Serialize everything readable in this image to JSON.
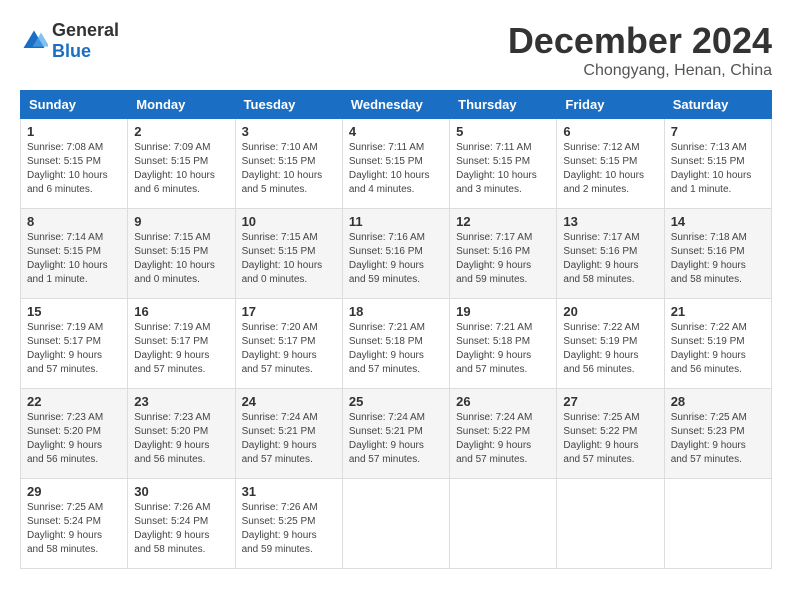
{
  "logo": {
    "text_general": "General",
    "text_blue": "Blue"
  },
  "header": {
    "month": "December 2024",
    "location": "Chongyang, Henan, China"
  },
  "weekdays": [
    "Sunday",
    "Monday",
    "Tuesday",
    "Wednesday",
    "Thursday",
    "Friday",
    "Saturday"
  ],
  "weeks": [
    [
      {
        "day": "1",
        "sunrise": "7:08 AM",
        "sunset": "5:15 PM",
        "daylight": "10 hours and 6 minutes."
      },
      {
        "day": "2",
        "sunrise": "7:09 AM",
        "sunset": "5:15 PM",
        "daylight": "10 hours and 6 minutes."
      },
      {
        "day": "3",
        "sunrise": "7:10 AM",
        "sunset": "5:15 PM",
        "daylight": "10 hours and 5 minutes."
      },
      {
        "day": "4",
        "sunrise": "7:11 AM",
        "sunset": "5:15 PM",
        "daylight": "10 hours and 4 minutes."
      },
      {
        "day": "5",
        "sunrise": "7:11 AM",
        "sunset": "5:15 PM",
        "daylight": "10 hours and 3 minutes."
      },
      {
        "day": "6",
        "sunrise": "7:12 AM",
        "sunset": "5:15 PM",
        "daylight": "10 hours and 2 minutes."
      },
      {
        "day": "7",
        "sunrise": "7:13 AM",
        "sunset": "5:15 PM",
        "daylight": "10 hours and 1 minute."
      }
    ],
    [
      {
        "day": "8",
        "sunrise": "7:14 AM",
        "sunset": "5:15 PM",
        "daylight": "10 hours and 1 minute."
      },
      {
        "day": "9",
        "sunrise": "7:15 AM",
        "sunset": "5:15 PM",
        "daylight": "10 hours and 0 minutes."
      },
      {
        "day": "10",
        "sunrise": "7:15 AM",
        "sunset": "5:15 PM",
        "daylight": "10 hours and 0 minutes."
      },
      {
        "day": "11",
        "sunrise": "7:16 AM",
        "sunset": "5:16 PM",
        "daylight": "9 hours and 59 minutes."
      },
      {
        "day": "12",
        "sunrise": "7:17 AM",
        "sunset": "5:16 PM",
        "daylight": "9 hours and 59 minutes."
      },
      {
        "day": "13",
        "sunrise": "7:17 AM",
        "sunset": "5:16 PM",
        "daylight": "9 hours and 58 minutes."
      },
      {
        "day": "14",
        "sunrise": "7:18 AM",
        "sunset": "5:16 PM",
        "daylight": "9 hours and 58 minutes."
      }
    ],
    [
      {
        "day": "15",
        "sunrise": "7:19 AM",
        "sunset": "5:17 PM",
        "daylight": "9 hours and 57 minutes."
      },
      {
        "day": "16",
        "sunrise": "7:19 AM",
        "sunset": "5:17 PM",
        "daylight": "9 hours and 57 minutes."
      },
      {
        "day": "17",
        "sunrise": "7:20 AM",
        "sunset": "5:17 PM",
        "daylight": "9 hours and 57 minutes."
      },
      {
        "day": "18",
        "sunrise": "7:21 AM",
        "sunset": "5:18 PM",
        "daylight": "9 hours and 57 minutes."
      },
      {
        "day": "19",
        "sunrise": "7:21 AM",
        "sunset": "5:18 PM",
        "daylight": "9 hours and 57 minutes."
      },
      {
        "day": "20",
        "sunrise": "7:22 AM",
        "sunset": "5:19 PM",
        "daylight": "9 hours and 56 minutes."
      },
      {
        "day": "21",
        "sunrise": "7:22 AM",
        "sunset": "5:19 PM",
        "daylight": "9 hours and 56 minutes."
      }
    ],
    [
      {
        "day": "22",
        "sunrise": "7:23 AM",
        "sunset": "5:20 PM",
        "daylight": "9 hours and 56 minutes."
      },
      {
        "day": "23",
        "sunrise": "7:23 AM",
        "sunset": "5:20 PM",
        "daylight": "9 hours and 56 minutes."
      },
      {
        "day": "24",
        "sunrise": "7:24 AM",
        "sunset": "5:21 PM",
        "daylight": "9 hours and 57 minutes."
      },
      {
        "day": "25",
        "sunrise": "7:24 AM",
        "sunset": "5:21 PM",
        "daylight": "9 hours and 57 minutes."
      },
      {
        "day": "26",
        "sunrise": "7:24 AM",
        "sunset": "5:22 PM",
        "daylight": "9 hours and 57 minutes."
      },
      {
        "day": "27",
        "sunrise": "7:25 AM",
        "sunset": "5:22 PM",
        "daylight": "9 hours and 57 minutes."
      },
      {
        "day": "28",
        "sunrise": "7:25 AM",
        "sunset": "5:23 PM",
        "daylight": "9 hours and 57 minutes."
      }
    ],
    [
      {
        "day": "29",
        "sunrise": "7:25 AM",
        "sunset": "5:24 PM",
        "daylight": "9 hours and 58 minutes."
      },
      {
        "day": "30",
        "sunrise": "7:26 AM",
        "sunset": "5:24 PM",
        "daylight": "9 hours and 58 minutes."
      },
      {
        "day": "31",
        "sunrise": "7:26 AM",
        "sunset": "5:25 PM",
        "daylight": "9 hours and 59 minutes."
      },
      null,
      null,
      null,
      null
    ]
  ]
}
